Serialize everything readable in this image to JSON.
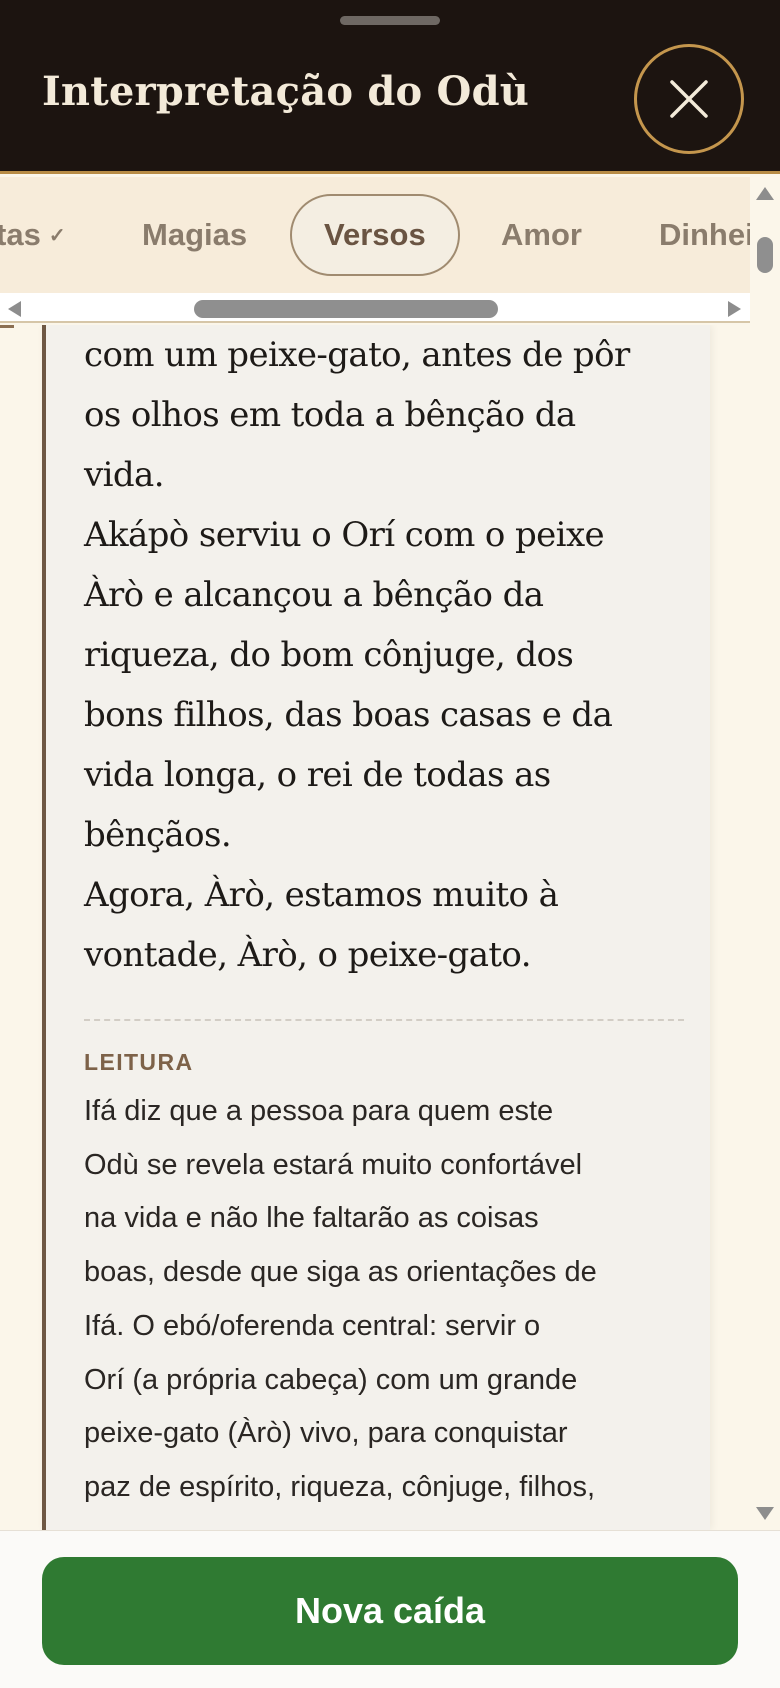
{
  "header": {
    "title": "Interpretação do Odù",
    "close_icon": "close-icon"
  },
  "tabs": [
    {
      "label": "tas",
      "check": "✓",
      "active": false
    },
    {
      "label": "Magias",
      "active": false
    },
    {
      "label": "Versos",
      "active": true
    },
    {
      "label": "Amor",
      "active": false
    },
    {
      "label": "Dinhei",
      "active": false
    }
  ],
  "verse": {
    "lines": [
      "com um peixe-gato, antes de pôr",
      "os olhos em toda a bênção da",
      "vida.",
      "Akápò serviu o Orí com o peixe",
      "Àrò e alcançou a bênção da",
      "riqueza, do bom cônjuge, dos",
      "bons filhos, das boas casas e da",
      "vida longa, o rei de todas as",
      "bênçãos.",
      "Agora, Àrò, estamos muito à",
      "vontade, Àrò, o peixe-gato."
    ]
  },
  "reading": {
    "label": "LEITURA",
    "lines": [
      "Ifá diz que a pessoa para quem este",
      "Odù se revela estará muito confortável",
      "na vida e não lhe faltarão as coisas",
      "boas, desde que siga as orientações de",
      "Ifá. O ebó/oferenda central: servir o",
      "Orí (a própria cabeça) com um grande",
      "peixe-gato (Àrò) vivo, para conquistar",
      "paz de espírito, riqueza, cônjuge, filhos,"
    ]
  },
  "footer": {
    "primary_label": "Nova caída"
  },
  "colors": {
    "header_bg": "#1c1410",
    "accent_gold": "#c4964d",
    "primary_green": "#2f7a32"
  }
}
